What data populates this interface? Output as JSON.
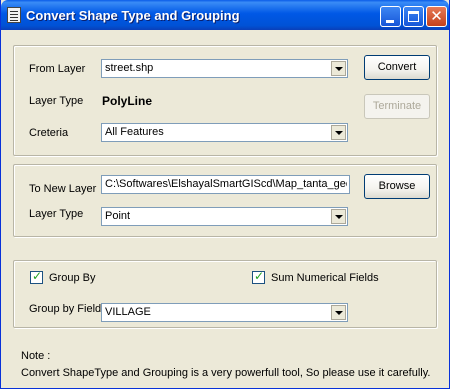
{
  "window": {
    "title": "Convert Shape Type and Grouping",
    "title_icon": "form-icon"
  },
  "source_section": {
    "from_layer_label": "From Layer",
    "from_layer_value": "street.shp",
    "layer_type_label": "Layer Type",
    "layer_type_value": "PolyLine",
    "criteria_label": "Creteria",
    "criteria_value": "All Features",
    "convert_button": "Convert",
    "terminate_button": "Terminate"
  },
  "target_section": {
    "to_new_layer_label": "To New Layer",
    "to_new_layer_value": "C:\\Softwares\\ElshayalSmartGIScd\\Map_tanta_geo",
    "browse_button": "Browse",
    "layer_type_label": "Layer Type",
    "layer_type_value": "Point"
  },
  "grouping_section": {
    "group_by_label": "Group By",
    "group_by_checked": true,
    "sum_numerical_label": "Sum Numerical Fields",
    "sum_numerical_checked": true,
    "group_by_field_label": "Group by Field",
    "group_by_field_value": "VILLAGE"
  },
  "note": {
    "heading": "Note :",
    "text": "Convert ShapeType and Grouping is a very powerfull tool, So please use it carefully."
  },
  "colors": {
    "titlebar": "#0058e6",
    "window_bg": "#ece9d8",
    "close_button": "#c3401c",
    "check_mark": "#21a121"
  }
}
